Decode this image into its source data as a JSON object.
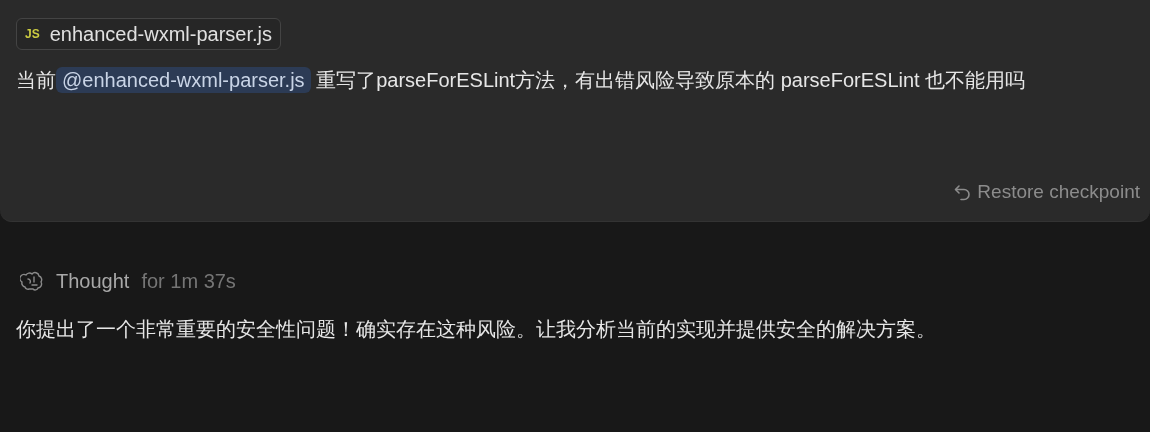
{
  "user_message": {
    "attachment": {
      "badge": "JS",
      "filename": "enhanced-wxml-parser.js"
    },
    "text_before": "当前",
    "mention": "@enhanced-wxml-parser.js",
    "text_after": " 重写了parseForESLint方法，有出错风险导致原本的 parseForESLint 也不能用吗",
    "restore_link": "Restore checkpoint"
  },
  "assistant": {
    "thought_label": "Thought",
    "thought_duration": "for 1m 37s",
    "answer": "你提出了一个非常重要的安全性问题！确实存在这种风险。让我分析当前的实现并提供安全的解决方案。"
  }
}
